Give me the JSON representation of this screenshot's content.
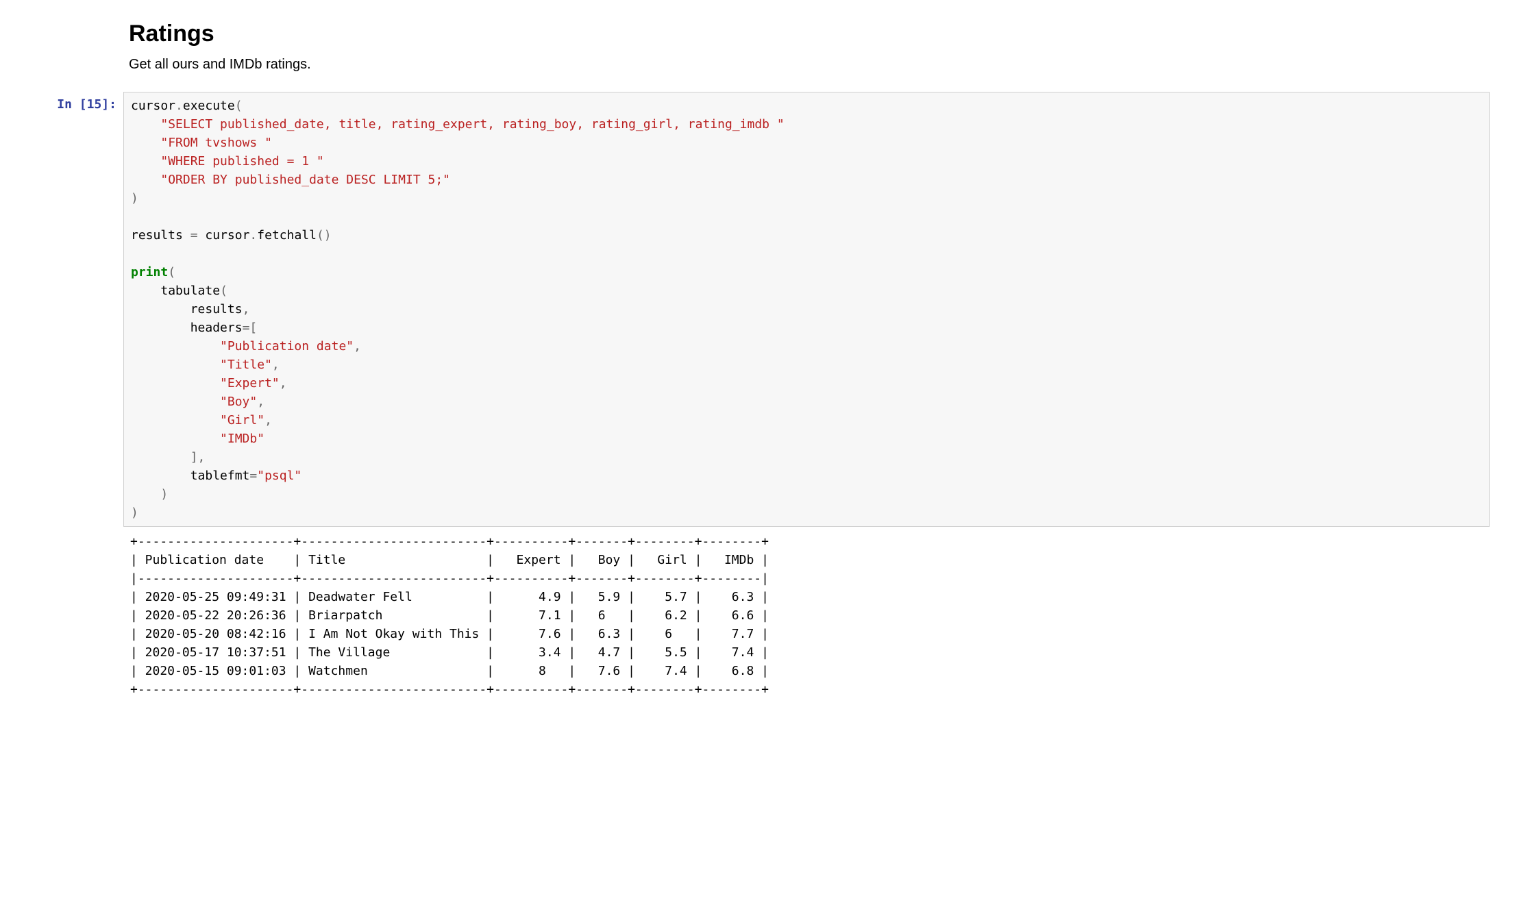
{
  "heading": "Ratings",
  "description": "Get all ours and IMDb ratings.",
  "prompt_label": "In [15]:",
  "code_html": "<span class=\"n\">cursor</span><span class=\"o\">.</span><span class=\"n\">execute</span><span class=\"o\">(</span>\n    <span class=\"s\">\"SELECT published_date, title, rating_expert, rating_boy, rating_girl, rating_imdb \"</span>\n    <span class=\"s\">\"FROM tvshows \"</span>\n    <span class=\"s\">\"WHERE published = 1 \"</span>\n    <span class=\"s\">\"ORDER BY published_date DESC LIMIT 5;\"</span>\n<span class=\"o\">)</span>\n\n<span class=\"n\">results</span> <span class=\"o\">=</span> <span class=\"n\">cursor</span><span class=\"o\">.</span><span class=\"n\">fetchall</span><span class=\"o\">()</span>\n\n<span class=\"k\">print</span><span class=\"o\">(</span>\n    <span class=\"n\">tabulate</span><span class=\"o\">(</span>\n        <span class=\"n\">results</span><span class=\"o\">,</span>\n        <span class=\"n\">headers</span><span class=\"o\">=[</span>\n            <span class=\"s\">\"Publication date\"</span><span class=\"o\">,</span>\n            <span class=\"s\">\"Title\"</span><span class=\"o\">,</span>\n            <span class=\"s\">\"Expert\"</span><span class=\"o\">,</span>\n            <span class=\"s\">\"Boy\"</span><span class=\"o\">,</span>\n            <span class=\"s\">\"Girl\"</span><span class=\"o\">,</span>\n            <span class=\"s\">\"IMDb\"</span>\n        <span class=\"o\">],</span>\n        <span class=\"n\">tablefmt</span><span class=\"o\">=</span><span class=\"s\">\"psql\"</span>\n    <span class=\"o\">)</span>\n<span class=\"o\">)</span>",
  "output_text": "+---------------------+-------------------------+----------+-------+--------+--------+\n| Publication date    | Title                   |   Expert |   Boy |   Girl |   IMDb |\n|---------------------+-------------------------+----------+-------+--------+--------|\n| 2020-05-25 09:49:31 | Deadwater Fell          |      4.9 |   5.9 |    5.7 |    6.3 |\n| 2020-05-22 20:26:36 | Briarpatch              |      7.1 |   6   |    6.2 |    6.6 |\n| 2020-05-20 08:42:16 | I Am Not Okay with This |      7.6 |   6.3 |    6   |    7.7 |\n| 2020-05-17 10:37:51 | The Village             |      3.4 |   4.7 |    5.5 |    7.4 |\n| 2020-05-15 09:01:03 | Watchmen                |      8   |   7.6 |    7.4 |    6.8 |\n+---------------------+-------------------------+----------+-------+--------+--------+",
  "chart_data": {
    "type": "table",
    "title": "Ratings",
    "columns": [
      "Publication date",
      "Title",
      "Expert",
      "Boy",
      "Girl",
      "IMDb"
    ],
    "rows": [
      [
        "2020-05-25 09:49:31",
        "Deadwater Fell",
        4.9,
        5.9,
        5.7,
        6.3
      ],
      [
        "2020-05-22 20:26:36",
        "Briarpatch",
        7.1,
        6,
        6.2,
        6.6
      ],
      [
        "2020-05-20 08:42:16",
        "I Am Not Okay with This",
        7.6,
        6.3,
        6,
        7.7
      ],
      [
        "2020-05-17 10:37:51",
        "The Village",
        3.4,
        4.7,
        5.5,
        7.4
      ],
      [
        "2020-05-15 09:01:03",
        "Watchmen",
        8,
        7.6,
        7.4,
        6.8
      ]
    ]
  }
}
